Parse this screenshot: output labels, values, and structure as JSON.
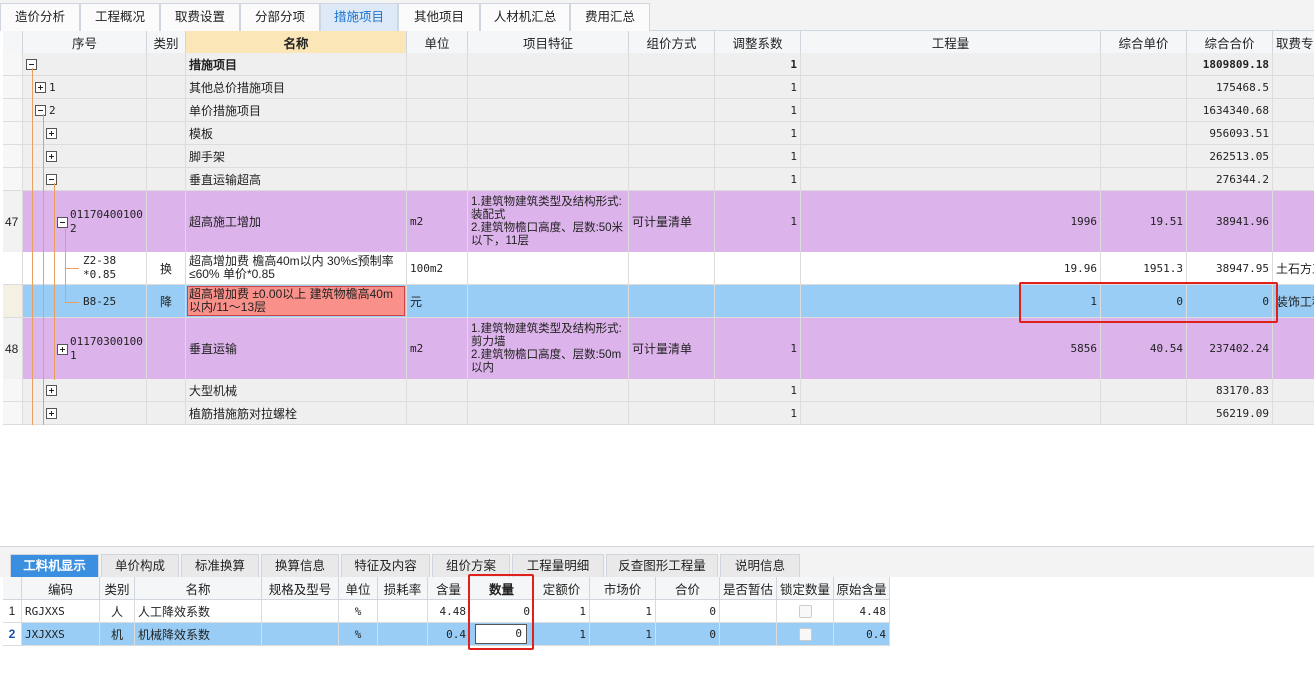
{
  "top_tabs": [
    {
      "label": "造价分析"
    },
    {
      "label": "工程概况"
    },
    {
      "label": "取费设置"
    },
    {
      "label": "分部分项"
    },
    {
      "label": "措施项目"
    },
    {
      "label": "其他项目"
    },
    {
      "label": "人材机汇总"
    },
    {
      "label": "费用汇总"
    }
  ],
  "main_grid": {
    "headers": {
      "seq": "序号",
      "type": "类别",
      "name": "名称",
      "unit": "单位",
      "feature": "项目特征",
      "method": "组价方式",
      "coef": "调整系数",
      "qty": "工程量",
      "unit_price": "综合单价",
      "total": "综合合价",
      "fee": "取费专"
    },
    "rows": [
      {
        "seq": "",
        "type": "",
        "name": "措施项目",
        "unit": "",
        "feature": "",
        "method": "",
        "coef": "1",
        "qty": "",
        "unit_price": "",
        "total": "1809809.18",
        "fee": ""
      },
      {
        "seq": "1",
        "type": "",
        "name": "其他总价措施项目",
        "unit": "",
        "feature": "",
        "method": "",
        "coef": "1",
        "qty": "",
        "unit_price": "",
        "total": "175468.5",
        "fee": ""
      },
      {
        "seq": "2",
        "type": "",
        "name": "单价措施项目",
        "unit": "",
        "feature": "",
        "method": "",
        "coef": "1",
        "qty": "",
        "unit_price": "",
        "total": "1634340.68",
        "fee": ""
      },
      {
        "seq": "",
        "type": "",
        "name": "模板",
        "unit": "",
        "feature": "",
        "method": "",
        "coef": "1",
        "qty": "",
        "unit_price": "",
        "total": "956093.51",
        "fee": ""
      },
      {
        "seq": "",
        "type": "",
        "name": "脚手架",
        "unit": "",
        "feature": "",
        "method": "",
        "coef": "1",
        "qty": "",
        "unit_price": "",
        "total": "262513.05",
        "fee": ""
      },
      {
        "seq": "",
        "type": "",
        "name": "垂直运输超高",
        "unit": "",
        "feature": "",
        "method": "",
        "coef": "1",
        "qty": "",
        "unit_price": "",
        "total": "276344.2",
        "fee": ""
      },
      {
        "rownum": "47",
        "seq": "011704001002",
        "type": "",
        "name": "超高施工增加",
        "unit": "m2",
        "feature": "1.建筑物建筑类型及结构形式:装配式\n2.建筑物檐口高度、层数:50米以下，11层",
        "method": "可计量清单",
        "coef": "1",
        "qty": "1996",
        "unit_price": "19.51",
        "total": "38941.96",
        "fee": ""
      },
      {
        "seq": "Z2-38\n*0.85",
        "type": "换",
        "name": "超高增加费 檐高40m以内  30%≤预制率≤60% 单价*0.85",
        "unit": "100m2",
        "feature": "",
        "method": "",
        "coef": "",
        "qty": "19.96",
        "unit_price": "1951.3",
        "total": "38947.95",
        "fee": "土石方工程"
      },
      {
        "seq": "B8-25",
        "type": "降",
        "name": "超高增加费 ±0.00以上 建筑物檐高40m以内/11～13层",
        "unit": "元",
        "feature": "",
        "method": "",
        "coef": "",
        "qty": "1",
        "unit_price": "0",
        "total": "0",
        "fee": "装饰工程"
      },
      {
        "rownum": "48",
        "seq": "011703001001",
        "type": "",
        "name": "垂直运输",
        "unit": "m2",
        "feature": "1.建筑物建筑类型及结构形式:剪力墙\n2.建筑物檐口高度、层数:50m以内",
        "method": "可计量清单",
        "coef": "1",
        "qty": "5856",
        "unit_price": "40.54",
        "total": "237402.24",
        "fee": ""
      },
      {
        "seq": "",
        "type": "",
        "name": "大型机械",
        "unit": "",
        "feature": "",
        "method": "",
        "coef": "1",
        "qty": "",
        "unit_price": "",
        "total": "83170.83",
        "fee": ""
      },
      {
        "seq": "",
        "type": "",
        "name": "植筋措施筋对拉螺栓",
        "unit": "",
        "feature": "",
        "method": "",
        "coef": "1",
        "qty": "",
        "unit_price": "",
        "total": "56219.09",
        "fee": ""
      }
    ]
  },
  "bottom_tabs": [
    {
      "label": "工料机显示"
    },
    {
      "label": "单价构成"
    },
    {
      "label": "标准换算"
    },
    {
      "label": "换算信息"
    },
    {
      "label": "特征及内容"
    },
    {
      "label": "组价方案"
    },
    {
      "label": "工程量明细"
    },
    {
      "label": "反查图形工程量"
    },
    {
      "label": "说明信息"
    }
  ],
  "bottom_grid": {
    "headers": {
      "code": "编码",
      "type": "类别",
      "name": "名称",
      "spec": "规格及型号",
      "unit": "单位",
      "loss": "损耗率",
      "content": "含量",
      "amount": "数量",
      "quota_price": "定额价",
      "market_price": "市场价",
      "sum": "合价",
      "tentative": "是否暂估",
      "lock": "锁定数量",
      "orig": "原始含量"
    },
    "rows": [
      {
        "idx": "1",
        "code": "RGJXXS",
        "type": "人",
        "name": "人工降效系数",
        "spec": "",
        "unit": "%",
        "loss": "",
        "content": "4.48",
        "amount": "0",
        "quota_price": "1",
        "market_price": "1",
        "sum": "0",
        "tentative": "",
        "orig": "4.48"
      },
      {
        "idx": "2",
        "code": "JXJXXS",
        "type": "机",
        "name": "机械降效系数",
        "spec": "",
        "unit": "%",
        "loss": "",
        "content": "0.4",
        "amount": "0",
        "quota_price": "1",
        "market_price": "1",
        "sum": "0",
        "tentative": "",
        "orig": "0.4"
      }
    ]
  },
  "colors": {
    "selected_row": "#99cdf5",
    "purple_row": "#dcb3ea",
    "highlight_red": "#e0201a",
    "active_tab": "#3b8fe0"
  }
}
